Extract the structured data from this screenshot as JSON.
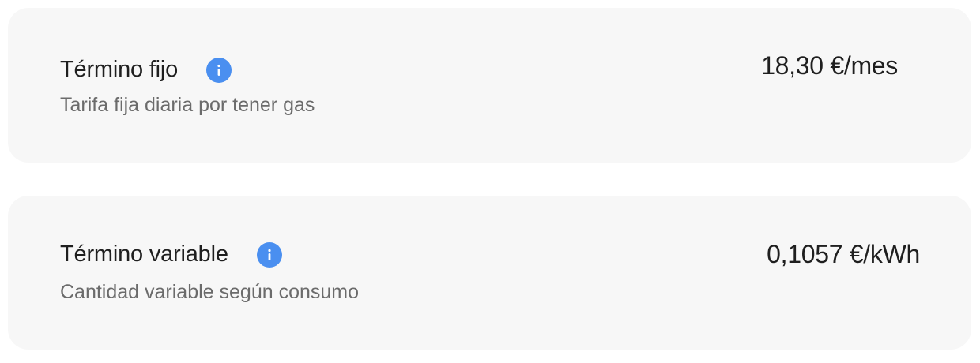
{
  "tariffs": [
    {
      "title": "Término fijo",
      "subtitle": "Tarifa fija diaria por tener gas",
      "value": "18,30 €/mes",
      "info_icon": "info-icon"
    },
    {
      "title": "Término variable",
      "subtitle": "Cantidad variable según consumo",
      "value": "0,1057 €/kWh",
      "info_icon": "info-icon"
    }
  ],
  "colors": {
    "card_background": "#f7f7f7",
    "info_icon": "#4a8ff0",
    "title_text": "#1f1f1f",
    "subtitle_text": "#6b6b6b"
  }
}
